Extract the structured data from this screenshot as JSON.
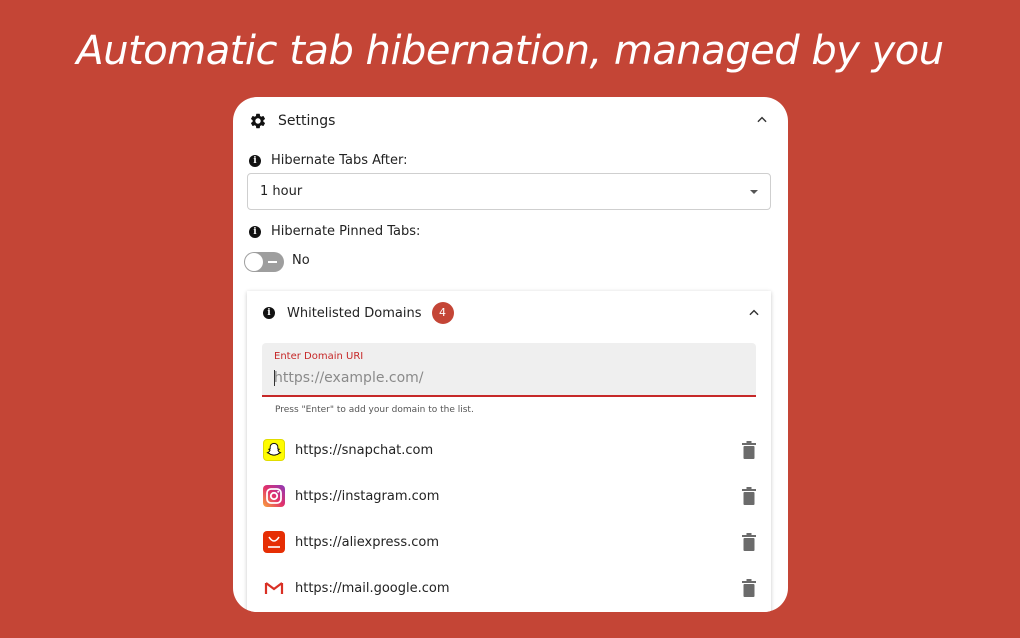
{
  "headline": "Automatic tab hibernation, managed by you",
  "settings": {
    "title": "Settings",
    "hibernate_after_label": "Hibernate Tabs After:",
    "hibernate_after_value": "1 hour",
    "pinned_label": "Hibernate Pinned Tabs:",
    "pinned_value": "No"
  },
  "whitelist": {
    "title": "Whitelisted Domains",
    "count": "4",
    "input_label": "Enter Domain URI",
    "input_placeholder": "https://example.com/",
    "helper": "Press \"Enter\" to add your domain to the list.",
    "domains": [
      {
        "url": "https://snapchat.com",
        "icon": "snapchat-icon"
      },
      {
        "url": "https://instagram.com",
        "icon": "instagram-icon"
      },
      {
        "url": "https://aliexpress.com",
        "icon": "aliexpress-icon"
      },
      {
        "url": "https://mail.google.com",
        "icon": "gmail-icon"
      }
    ]
  },
  "colors": {
    "background": "#c44536",
    "accent": "#c62828",
    "snapchat": "#fffc00",
    "aliexpress": "#e62e04",
    "gmail": "#d93025"
  }
}
